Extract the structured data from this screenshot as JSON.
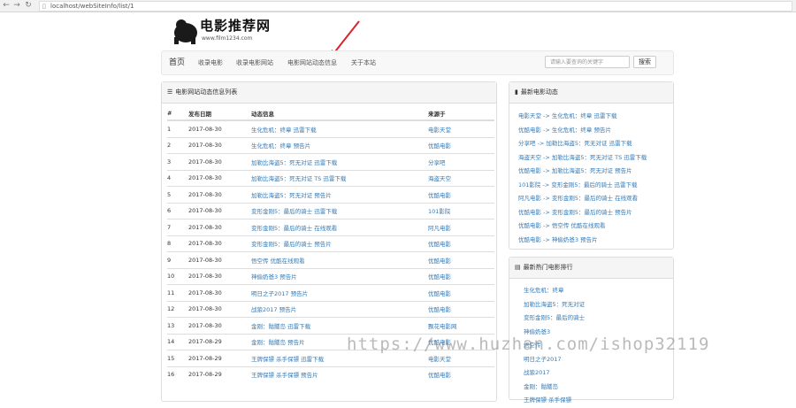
{
  "browser": {
    "url": "localhost/webSiteInfo/list/1"
  },
  "logo": {
    "title": "电影推荐网",
    "subtitle": "www.film1234.com"
  },
  "nav": {
    "home": "首页",
    "items": [
      "收录电影",
      "收录电影网站",
      "电影网站动态信息",
      "关于本站"
    ],
    "search_placeholder": "请输入要查询的关键字",
    "search_button": "搜索"
  },
  "main_panel": {
    "title": "电影网站动态信息列表",
    "columns": [
      "#",
      "发布日期",
      "动态信息",
      "来源于"
    ],
    "rows": [
      {
        "n": "1",
        "date": "2017-08-30",
        "info": "生化危机：终章 迅雷下载",
        "src": "电影天堂"
      },
      {
        "n": "2",
        "date": "2017-08-30",
        "info": "生化危机：终章 预告片",
        "src": "优酷电影"
      },
      {
        "n": "3",
        "date": "2017-08-30",
        "info": "加勒比海盗5：死无对证 迅雷下载",
        "src": "分享吧"
      },
      {
        "n": "4",
        "date": "2017-08-30",
        "info": "加勒比海盗5：死无对证 TS 迅雷下载",
        "src": "海盗天空"
      },
      {
        "n": "5",
        "date": "2017-08-30",
        "info": "加勒比海盗5：死无对证 预告片",
        "src": "优酷电影"
      },
      {
        "n": "6",
        "date": "2017-08-30",
        "info": "变形金刚5：最后的骑士 迅雷下载",
        "src": "101影院"
      },
      {
        "n": "7",
        "date": "2017-08-30",
        "info": "变形金刚5：最后的骑士 在线观看",
        "src": "阿凡电影"
      },
      {
        "n": "8",
        "date": "2017-08-30",
        "info": "变形金刚5：最后的骑士 预告片",
        "src": "优酷电影"
      },
      {
        "n": "9",
        "date": "2017-08-30",
        "info": "悟空传 优酷在线观看",
        "src": "优酷电影"
      },
      {
        "n": "10",
        "date": "2017-08-30",
        "info": "神偷奶爸3 预告片",
        "src": "优酷电影"
      },
      {
        "n": "11",
        "date": "2017-08-30",
        "info": "明日之子2017 预告片",
        "src": "优酷电影"
      },
      {
        "n": "12",
        "date": "2017-08-30",
        "info": "战狼2017 预告片",
        "src": "优酷电影"
      },
      {
        "n": "13",
        "date": "2017-08-30",
        "info": "金刚：骷髅岛 迅雷下载",
        "src": "飘花电影网"
      },
      {
        "n": "14",
        "date": "2017-08-29",
        "info": "金刚：骷髅岛 预告片",
        "src": "优酷电影"
      },
      {
        "n": "15",
        "date": "2017-08-29",
        "info": "王牌保镖 杀手保镖 迅雷下载",
        "src": "电影天堂"
      },
      {
        "n": "16",
        "date": "2017-08-29",
        "info": "王牌保镖 杀手保镖 预告片",
        "src": "优酷电影"
      }
    ]
  },
  "side_news": {
    "title": "最新电影动态",
    "items": [
      "电影天堂 -> 生化危机：终章 迅雷下载",
      "优酷电影 -> 生化危机：终章 预告片",
      "分享吧 -> 加勒比海盗5：死无对证 迅雷下载",
      "海盗天空 -> 加勒比海盗5：死无对证 TS 迅雷下载",
      "优酷电影 -> 加勒比海盗5：死无对证 预告片",
      "101影院 -> 变形金刚5：最后的骑士 迅雷下载",
      "阿凡电影 -> 变形金刚5：最后的骑士 在线观看",
      "优酷电影 -> 变形金刚5：最后的骑士 预告片",
      "优酷电影 -> 悟空传 优酷在线观看",
      "优酷电影 -> 神偷奶爸3 预告片"
    ]
  },
  "side_hot": {
    "title": "最新热门电影排行",
    "items": [
      "生化危机：终章",
      "加勒比海盗5：死无对证",
      "变形金刚5：最后的骑士",
      "神偷奶爸3",
      "悟空传",
      "明日之子2017",
      "战狼2017",
      "金刚：骷髅岛",
      "王牌保镖 杀手保镖"
    ]
  },
  "watermark": "https://www.huzhan.com/ishop32119"
}
